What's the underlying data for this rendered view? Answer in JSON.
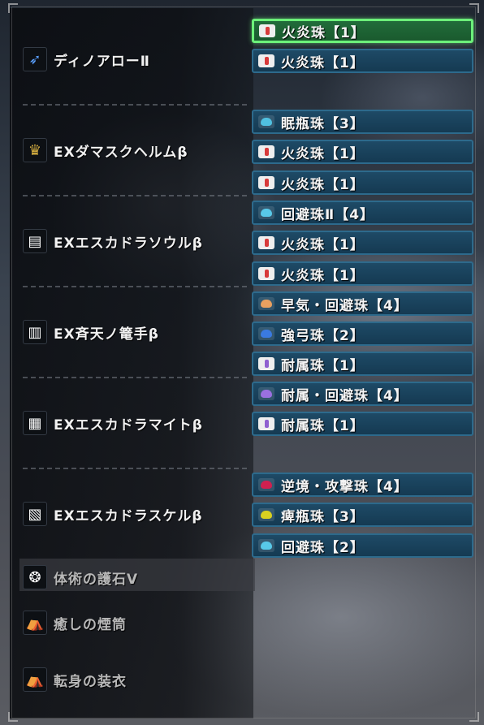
{
  "equipment": [
    {
      "name": "ディノアローⅡ",
      "icon": "bow-icon",
      "icon_color": "#5aa0ff",
      "dim": false
    },
    {
      "name": "EXダマスクヘルムβ",
      "icon": "helm-icon",
      "icon_color": "#d8b040",
      "dim": false
    },
    {
      "name": "EXエスカドラソウルβ",
      "icon": "chest-icon",
      "icon_color": "#ffffff",
      "dim": false
    },
    {
      "name": "EX斉天ノ篭手β",
      "icon": "arms-icon",
      "icon_color": "#ffffff",
      "dim": false
    },
    {
      "name": "EXエスカドラマイトβ",
      "icon": "waist-icon",
      "icon_color": "#ffffff",
      "dim": false
    },
    {
      "name": "EXエスカドラスケルβ",
      "icon": "legs-icon",
      "icon_color": "#ffffff",
      "dim": false
    },
    {
      "name": "体術の護石Ⅴ",
      "icon": "charm-icon",
      "icon_color": "#ffffff",
      "dim": true
    },
    {
      "name": "癒しの煙筒",
      "icon": "mantle-icon",
      "icon_color": "#40d080",
      "dim": true
    },
    {
      "name": "転身の装衣",
      "icon": "mantle-icon",
      "icon_color": "#e8d0a0",
      "dim": true
    }
  ],
  "decorations": [
    {
      "name": "火炎珠【1】",
      "size": 1,
      "color": "#d83a3a",
      "selected": true
    },
    {
      "name": "火炎珠【1】",
      "size": 1,
      "color": "#d83a3a",
      "selected": false
    },
    {
      "name": "眠瓶珠【3】",
      "size": 3,
      "color": "#50c0e0",
      "selected": false
    },
    {
      "name": "火炎珠【1】",
      "size": 1,
      "color": "#d83a3a",
      "selected": false
    },
    {
      "name": "火炎珠【1】",
      "size": 1,
      "color": "#d83a3a",
      "selected": false
    },
    {
      "name": "回避珠Ⅱ【4】",
      "size": 4,
      "color": "#58c8e8",
      "selected": false
    },
    {
      "name": "火炎珠【1】",
      "size": 1,
      "color": "#d83a3a",
      "selected": false
    },
    {
      "name": "火炎珠【1】",
      "size": 1,
      "color": "#d83a3a",
      "selected": false
    },
    {
      "name": "早気・回避珠【4】",
      "size": 4,
      "color": "#e8a060",
      "selected": false
    },
    {
      "name": "強弓珠【2】",
      "size": 2,
      "color": "#3a7ae0",
      "selected": false
    },
    {
      "name": "耐属珠【1】",
      "size": 1,
      "color": "#9060d0",
      "selected": false
    },
    {
      "name": "耐属・回避珠【4】",
      "size": 4,
      "color": "#9a70e0",
      "selected": false
    },
    {
      "name": "耐属珠【1】",
      "size": 1,
      "color": "#9060d0",
      "selected": false
    },
    {
      "name": "逆境・攻撃珠【4】",
      "size": 4,
      "color": "#d02050",
      "selected": false
    },
    {
      "name": "痺瓶珠【3】",
      "size": 3,
      "color": "#d8d020",
      "selected": false
    },
    {
      "name": "回避珠【2】",
      "size": 2,
      "color": "#58c8e8",
      "selected": false
    }
  ]
}
